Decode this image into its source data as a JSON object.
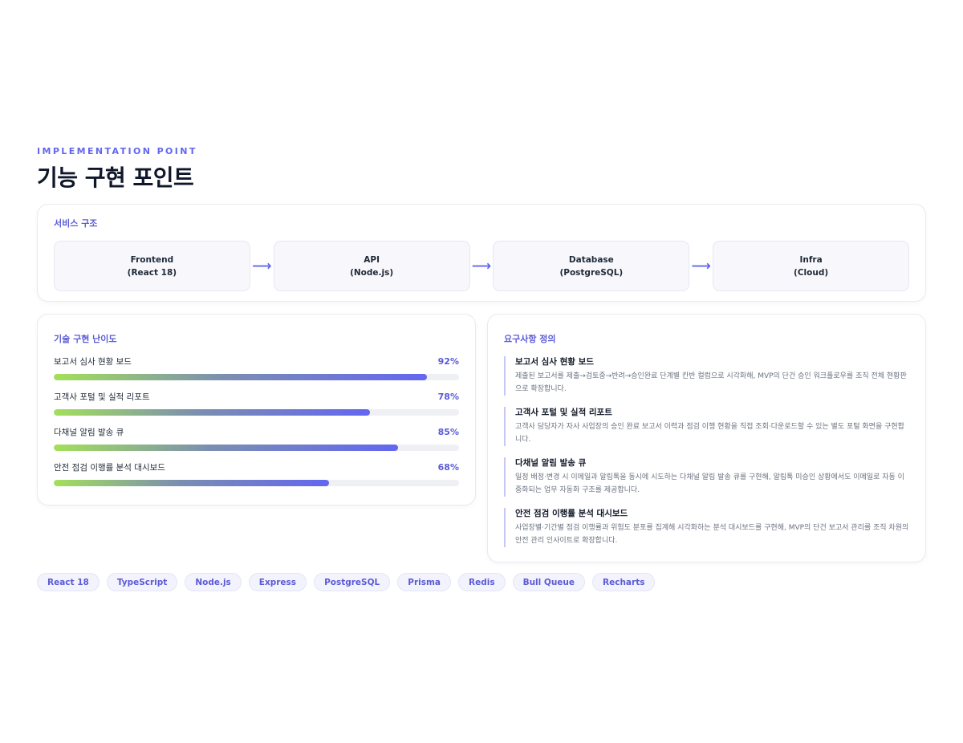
{
  "header": {
    "eyebrow": "IMPLEMENTATION POINT",
    "title": "기능 구현 포인트"
  },
  "structure": {
    "title": "서비스 구조",
    "arrow": "⟶",
    "nodes": [
      {
        "name": "Frontend",
        "detail": "(React 18)"
      },
      {
        "name": "API",
        "detail": "(Node.js)"
      },
      {
        "name": "Database",
        "detail": "(PostgreSQL)"
      },
      {
        "name": "Infra",
        "detail": "(Cloud)"
      }
    ]
  },
  "difficulty": {
    "title": "기술 구현 난이도",
    "items": [
      {
        "label": "보고서 심사 현황 보드",
        "percent": 92,
        "percent_text": "92%"
      },
      {
        "label": "고객사 포털 및 실적 리포트",
        "percent": 78,
        "percent_text": "78%"
      },
      {
        "label": "다채널 알림 발송 큐",
        "percent": 85,
        "percent_text": "85%"
      },
      {
        "label": "안전 점검 이행률 분석 대시보드",
        "percent": 68,
        "percent_text": "68%"
      }
    ]
  },
  "requirements": {
    "title": "요구사항 정의",
    "items": [
      {
        "title": "보고서 심사 현황 보드",
        "desc": "제출된 보고서를 제출→검토중→반려→승인완료 단계별 칸반 컬럼으로 시각화해, MVP의 단건 승인 워크플로우를 조직 전체 현황판으로 확장합니다."
      },
      {
        "title": "고객사 포털 및 실적 리포트",
        "desc": "고객사 담당자가 자사 사업장의 승인 완료 보고서 이력과 점검 이행 현황을 직접 조회·다운로드할 수 있는 별도 포털 화면을 구현합니다."
      },
      {
        "title": "다채널 알림 발송 큐",
        "desc": "일정 배정·변경 시 이메일과 알림톡을 동시에 시도하는 다채널 알림 발송 큐를 구현해, 알림톡 미승인 상황에서도 이메일로 자동 이중화되는 업무 자동화 구조를 제공합니다."
      },
      {
        "title": "안전 점검 이행률 분석 대시보드",
        "desc": "사업장별·기간별 점검 이행률과 위험도 분포를 집계해 시각화하는 분석 대시보드를 구현해, MVP의 단건 보고서 관리를 조직 차원의 안전 관리 인사이트로 확장합니다."
      }
    ]
  },
  "tags": [
    "React 18",
    "TypeScript",
    "Node.js",
    "Express",
    "PostgreSQL",
    "Prisma",
    "Redis",
    "Bull Queue",
    "Recharts"
  ]
}
